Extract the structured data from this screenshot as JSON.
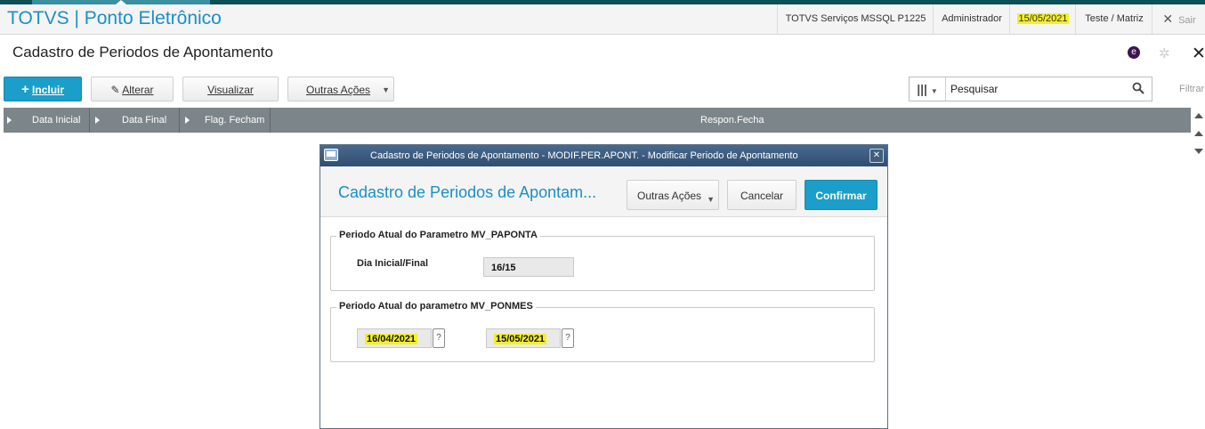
{
  "header": {
    "app_title": "TOTVS | Ponto Eletrônico",
    "server": "TOTVS Serviços MSSQL P1225",
    "user": "Administrador",
    "date": "15/05/2021",
    "company": "Teste / Matriz",
    "exit_label": "Sair"
  },
  "page": {
    "title": "Cadastro de Periodos de Apontamento"
  },
  "toolbar": {
    "incluir": "Incluir",
    "alterar": "Alterar",
    "visualizar": "Visualizar",
    "outras_acoes": "Outras Ações",
    "search_placeholder": "Pesquisar",
    "filtrar": "Filtrar"
  },
  "grid": {
    "columns": [
      "Data Inicial",
      "Data Final",
      "Flag. Fecham",
      "Respon.Fecha"
    ]
  },
  "modal": {
    "window_title": "Cadastro de Periodos de Apontamento - MODIF.PER.APONT. - Modificar Periodo de Apontamento",
    "heading": "Cadastro de Periodos de Apontam...",
    "outras_acoes": "Outras Ações",
    "cancelar": "Cancelar",
    "confirmar": "Confirmar",
    "group1": {
      "legend": "Periodo Atual do Parametro MV_PAPONTA",
      "label": "Dia Inicial/Final",
      "value": "16/15"
    },
    "group2": {
      "legend": "Periodo Atual do parametro MV_PONMES",
      "start_date": "16/04/2021",
      "end_date": "15/05/2021",
      "help": "?"
    }
  },
  "colors": {
    "brand_blue": "#1b8fc5",
    "primary_button": "#1b9ec9",
    "grid_header": "#7c868a",
    "highlight": "#f3ef2a"
  }
}
